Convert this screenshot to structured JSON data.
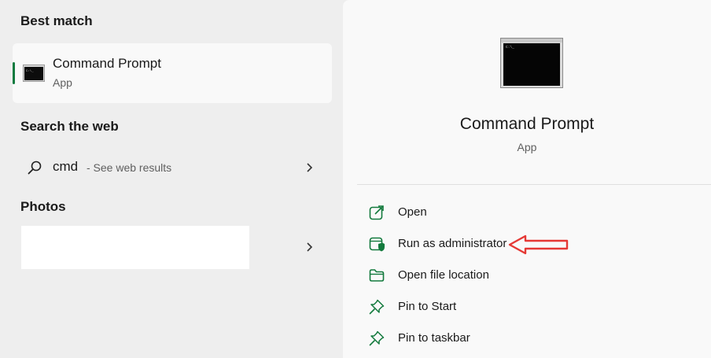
{
  "left": {
    "best_match_heading": "Best match",
    "best_match": {
      "title": "Command Prompt",
      "subtitle": "App"
    },
    "search_web_heading": "Search the web",
    "web_result": {
      "query": "cmd",
      "hint": "- See web results"
    },
    "photos_heading": "Photos"
  },
  "right": {
    "title": "Command Prompt",
    "subtitle": "App",
    "actions": [
      {
        "label": "Open",
        "icon": "open-external-icon"
      },
      {
        "label": "Run as administrator",
        "icon": "shield-window-icon"
      },
      {
        "label": "Open file location",
        "icon": "folder-icon"
      },
      {
        "label": "Pin to Start",
        "icon": "pin-icon"
      },
      {
        "label": "Pin to taskbar",
        "icon": "pin-icon"
      }
    ]
  },
  "colors": {
    "accent": "#0f7b3f",
    "icon_green": "#137a3d",
    "annotation": "#e53935"
  }
}
